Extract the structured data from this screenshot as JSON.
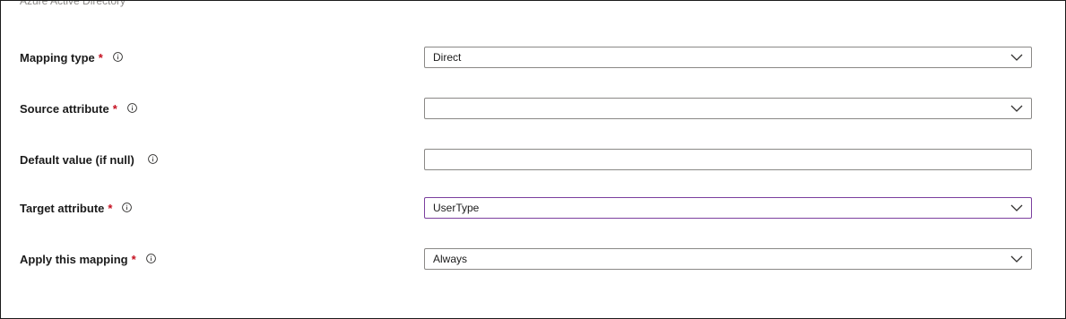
{
  "header": {
    "caption": "Azure Active Directory"
  },
  "form": {
    "fields": [
      {
        "label": "Mapping type",
        "required": "*",
        "control": "dropdown",
        "value": "Direct",
        "icon": "info-icon"
      },
      {
        "label": "Source attribute",
        "required": "*",
        "control": "dropdown",
        "value": "",
        "icon": "info-icon"
      },
      {
        "label": "Default value (if null)",
        "required": "",
        "control": "textbox",
        "value": "",
        "icon": "info-icon"
      },
      {
        "label": "Target attribute",
        "required": "*",
        "control": "dropdown",
        "value": "UserType",
        "icon": "info-icon",
        "focused": true
      },
      {
        "label": "Apply this mapping",
        "required": "*",
        "control": "dropdown",
        "value": "Always",
        "icon": "info-icon"
      }
    ]
  },
  "colors": {
    "required_asterisk": "#c50f1f",
    "focus_border": "#7b3f9e",
    "input_border": "#8a8886",
    "caption_text": "#8a8886"
  }
}
